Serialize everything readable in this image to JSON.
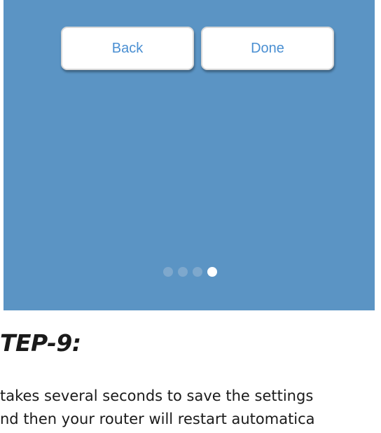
{
  "buttons": {
    "back_label": "Back",
    "done_label": "Done"
  },
  "pager": {
    "total": 4,
    "current": 4
  },
  "step": {
    "title": "TEP-9:",
    "lines": [
      "takes several seconds to save the settings",
      "nd then your router will restart automatica"
    ]
  },
  "colors": {
    "panel_background": "#5b94c4",
    "button_text": "#4a8fd2",
    "dot_inactive": "#7ea8cd",
    "dot_active": "#ffffff"
  }
}
